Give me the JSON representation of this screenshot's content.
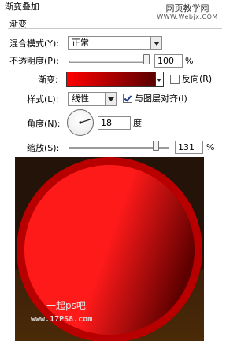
{
  "dialog": {
    "group_title": "渐变叠加",
    "sub_title": "渐变",
    "watermark_top": "网页教学网",
    "watermark_top_sub": "WWW.Webjx.COM",
    "blend_mode": {
      "label": "混合模式(Y):",
      "value": "正常"
    },
    "opacity": {
      "label": "不透明度(P):",
      "value": "100",
      "unit": "%",
      "level": 1.0
    },
    "gradient": {
      "label": "渐变:",
      "from_color": "#ff0000",
      "to_color": "#5a0000",
      "reverse_label": "反向(R)",
      "reverse_checked": false
    },
    "style": {
      "label": "样式(L):",
      "value": "线性",
      "align_label": "与图层对齐(I)",
      "align_checked": true
    },
    "angle": {
      "label": "角度(N):",
      "value": "18",
      "unit": "度"
    },
    "scale": {
      "label": "缩放(S):",
      "value": "131",
      "unit": "%",
      "level": 0.87
    }
  },
  "canvas": {
    "watermark_line1": "一起ps吧",
    "watermark_line2": "www.17PS8.com",
    "colors": {
      "bg_top": "#241308",
      "bg_band": "#3c2009",
      "bg_bottom": "#4a2a08",
      "circle_light": "#ff1a1a",
      "circle_dark": "#5e0000",
      "rim": "#b80000"
    }
  }
}
